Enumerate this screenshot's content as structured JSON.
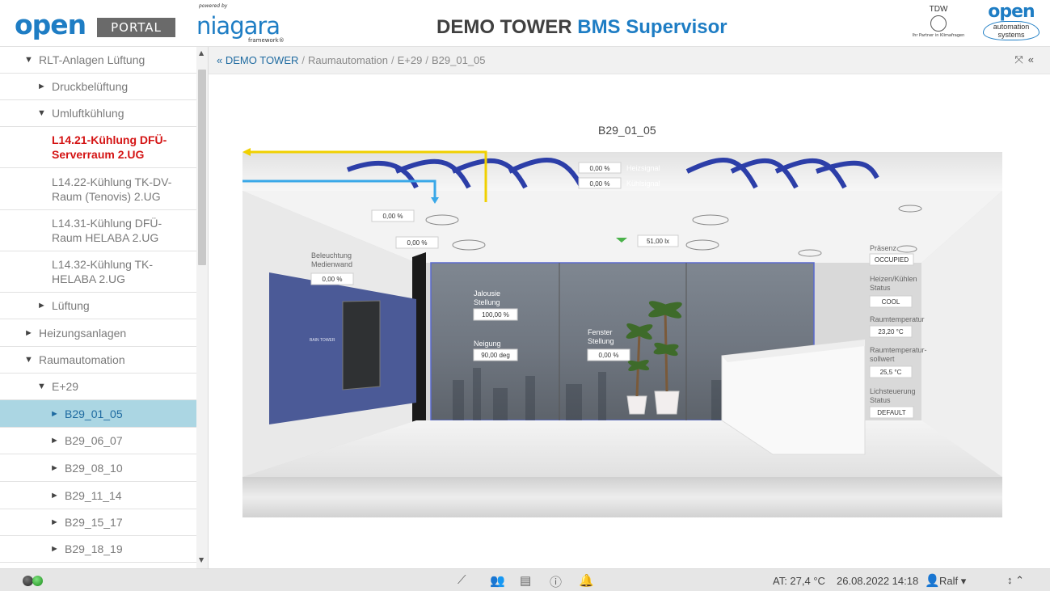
{
  "header": {
    "logo_open": "open",
    "logo_portal": "PORTAL",
    "powered_by": "powered by",
    "niagara": "niagara",
    "niagara_sub": "framework®",
    "title_plain": "DEMO TOWER ",
    "title_accent": "BMS Supervisor",
    "tdw_label": "TDW",
    "tdw_sub": "Ihr Partner in Klimafragen",
    "oas_open": "open",
    "oas_text_1": "automation",
    "oas_text_2": "systems"
  },
  "sidebar": {
    "items": [
      {
        "label": "RLT-Anlagen Lüftung",
        "arrow": "▼",
        "indent": 0
      },
      {
        "label": "Druckbelüftung",
        "arrow": "►",
        "indent": 1
      },
      {
        "label": "Umluftkühlung",
        "arrow": "▼",
        "indent": 1
      },
      {
        "label": "L14.21-Kühlung DFÜ-Serverraum 2.UG",
        "arrow": "",
        "indent": 2,
        "state": "red"
      },
      {
        "label": "L14.22-Kühlung TK-DV-Raum (Tenovis) 2.UG",
        "arrow": "",
        "indent": 2
      },
      {
        "label": "L14.31-Kühlung DFÜ-Raum HELABA 2.UG",
        "arrow": "",
        "indent": 2
      },
      {
        "label": "L14.32-Kühlung TK-HELABA 2.UG",
        "arrow": "",
        "indent": 2
      },
      {
        "label": "Lüftung",
        "arrow": "►",
        "indent": 1
      },
      {
        "label": "Heizungsanlagen",
        "arrow": "►",
        "indent": 0
      },
      {
        "label": "Raumautomation",
        "arrow": "▼",
        "indent": 0
      },
      {
        "label": "E+29",
        "arrow": "▼",
        "indent": 1
      },
      {
        "label": "B29_01_05",
        "arrow": "►",
        "indent": 2,
        "state": "active"
      },
      {
        "label": "B29_06_07",
        "arrow": "►",
        "indent": 2
      },
      {
        "label": "B29_08_10",
        "arrow": "►",
        "indent": 2
      },
      {
        "label": "B29_11_14",
        "arrow": "►",
        "indent": 2
      },
      {
        "label": "B29_15_17",
        "arrow": "►",
        "indent": 2
      },
      {
        "label": "B29_18_19",
        "arrow": "►",
        "indent": 2
      }
    ]
  },
  "breadcrumb": {
    "back": "«",
    "root": "DEMO TOWER",
    "items": [
      "Raumautomation",
      "E+29",
      "B29_01_05"
    ],
    "sep": "/"
  },
  "room": {
    "title": "B29_01_05",
    "heizsignal_value": "0,00 %",
    "heizsignal_label": "Heizsignal",
    "kuehlsignal_value": "0,00 %",
    "kuehlsignal_label": "Kühlsignal",
    "light1_value": "0,00 %",
    "light2_value": "0,00 %",
    "lux_value": "51,00 lx",
    "beleuchtung_label_1": "Beleuchtung",
    "beleuchtung_label_2": "Medienwand",
    "beleuchtung_value": "0,00 %",
    "jalousie_label_1": "Jalousie",
    "jalousie_label_2": "Stellung",
    "jalousie_value": "100,00 %",
    "neigung_label": "Neigung",
    "neigung_value": "90,00 deg",
    "fenster_label_1": "Fenster",
    "fenster_label_2": "Stellung",
    "fenster_value": "0,00 %",
    "praesenz_label": "Präsenz",
    "praesenz_value": "OCCUPIED",
    "heizen_label_1": "Heizen/Kühlen",
    "heizen_label_2": "Status",
    "heizen_value": "COOL",
    "raumtemp_label": "Raumtemperatur",
    "raumtemp_value": "23,20 °C",
    "soll_label_1": "Raumtemperatur-",
    "soll_label_2": "sollwert",
    "soll_value": "25,5 °C",
    "licht_label_1": "Lichsteuerung",
    "licht_label_2": "Status",
    "licht_value": "DEFAULT",
    "medienwand_logo": "BAIN TOWER"
  },
  "statusbar": {
    "at": "AT: 27,4 °C",
    "datetime": "26.08.2022 14:18",
    "user": "Ralf"
  },
  "colors": {
    "brand_blue": "#1e7dc4",
    "active_row": "#abd6e3",
    "alarm_red": "#d41414",
    "pipe_yellow": "#f0d000",
    "pipe_blue": "#3aa8e8"
  }
}
